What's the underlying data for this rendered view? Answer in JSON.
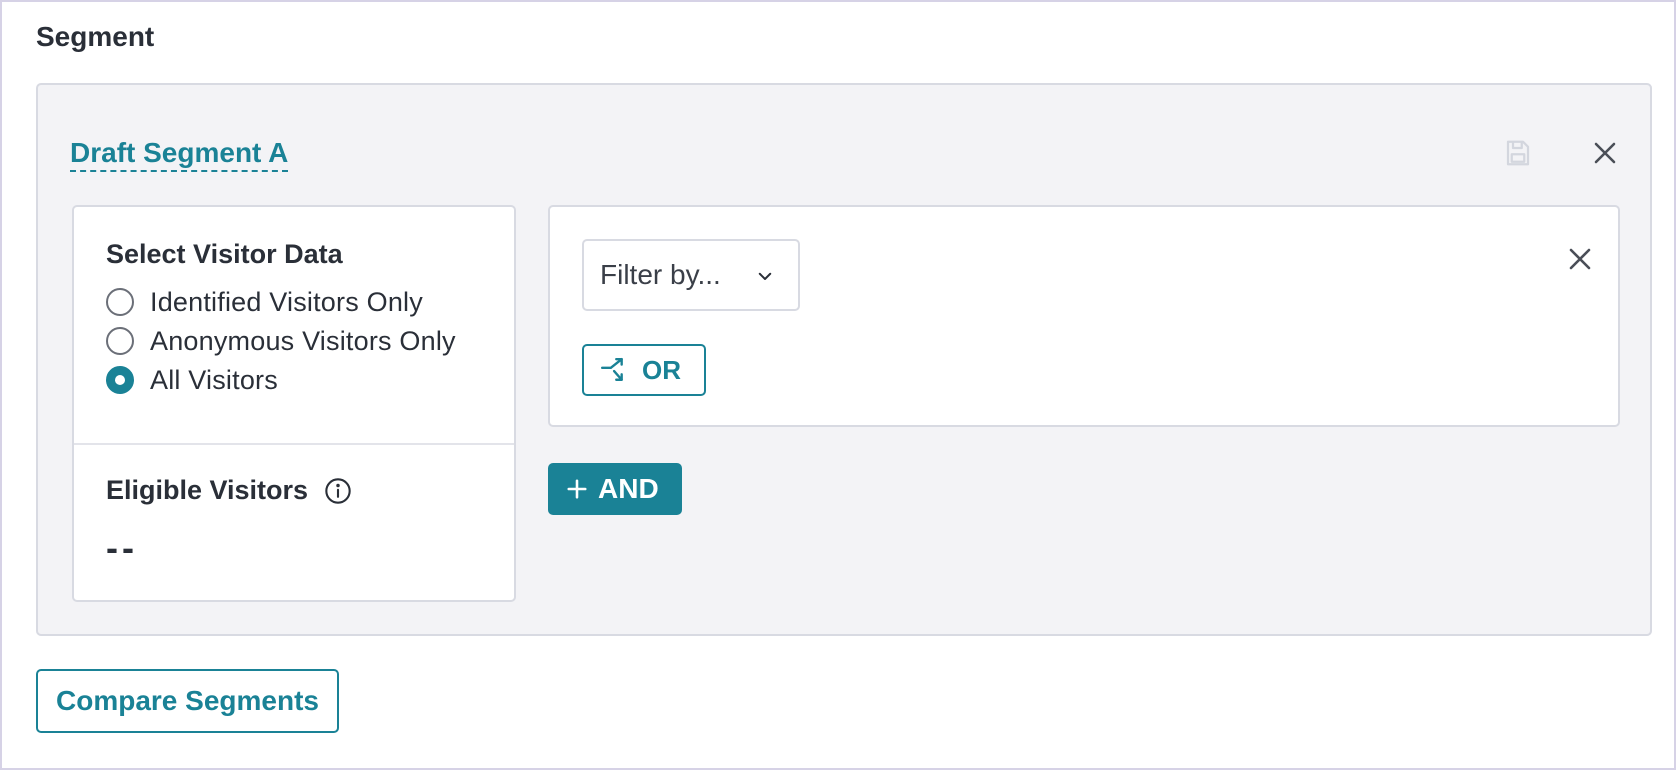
{
  "section_title": "Segment",
  "segment": {
    "name": "Draft Segment A",
    "save_icon": "save-icon",
    "close_icon": "close-icon"
  },
  "visitor_data": {
    "heading": "Select Visitor Data",
    "options": [
      {
        "label": "Identified Visitors Only",
        "checked": false
      },
      {
        "label": "Anonymous Visitors Only",
        "checked": false
      },
      {
        "label": "All Visitors",
        "checked": true
      }
    ],
    "eligible_heading": "Eligible Visitors",
    "eligible_value": "--",
    "info_icon": "info-icon"
  },
  "filter": {
    "select_label": "Filter by...",
    "or_label": "OR",
    "or_icon": "split-icon",
    "close_icon": "close-icon"
  },
  "and_label": "AND",
  "compare_label": "Compare Segments",
  "colors": {
    "accent": "#1a8296",
    "card_bg": "#f3f3f6",
    "border": "#d8dae2",
    "text": "#2a2f38"
  }
}
